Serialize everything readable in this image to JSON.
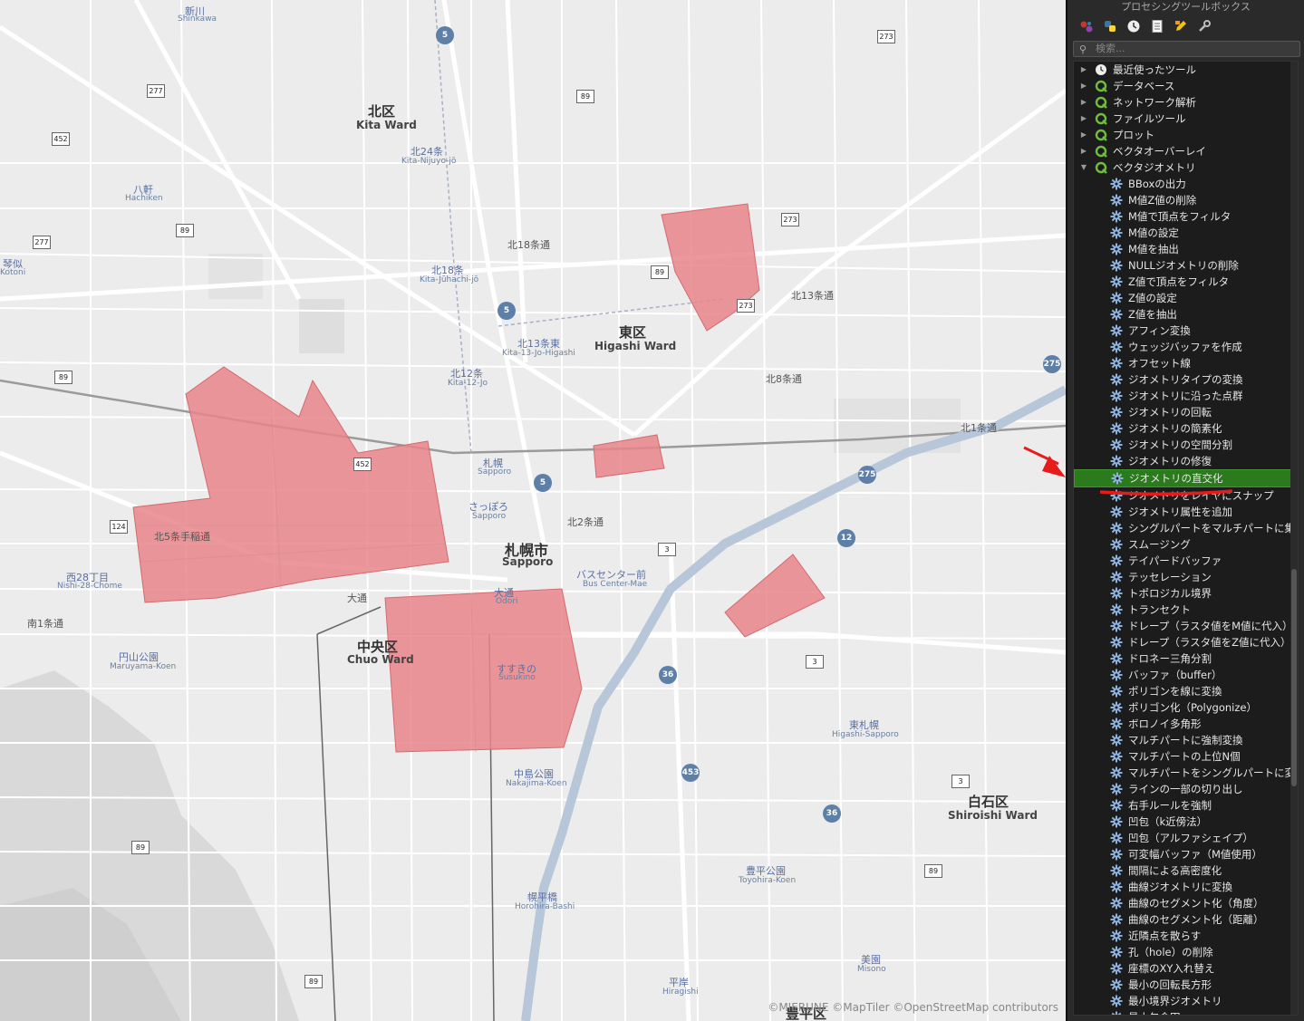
{
  "panel": {
    "title": "プロセシングツールボックス",
    "search_placeholder": "検索...",
    "groups": [
      {
        "label": "最近使ったツール",
        "icon": "clock-icon"
      },
      {
        "label": "データベース",
        "icon": "qgis-icon"
      },
      {
        "label": "ネットワーク解析",
        "icon": "qgis-icon"
      },
      {
        "label": "ファイルツール",
        "icon": "qgis-icon"
      },
      {
        "label": "プロット",
        "icon": "qgis-icon"
      },
      {
        "label": "ベクタオーバーレイ",
        "icon": "qgis-icon"
      },
      {
        "label": "ベクタジオメトリ",
        "icon": "qgis-icon"
      }
    ],
    "tools": [
      "BBoxの出力",
      "M値Z値の削除",
      "M値で頂点をフィルタ",
      "M値の設定",
      "M値を抽出",
      "NULLジオメトリの削除",
      "Z値で頂点をフィルタ",
      "Z値の設定",
      "Z値を抽出",
      "アフィン変換",
      "ウェッジバッファを作成",
      "オフセット線",
      "ジオメトリタイプの変換",
      "ジオメトリに沿った点群",
      "ジオメトリの回転",
      "ジオメトリの簡素化",
      "ジオメトリの空間分割",
      "ジオメトリの修復",
      "ジオメトリの直交化",
      "ジオメトリをレイヤにスナップ",
      "ジオメトリ属性を追加",
      "シングルパートをマルチパートに集約",
      "スムージング",
      "テイパードバッファ",
      "テッセレーション",
      "トポロジカル境界",
      "トランセクト",
      "ドレープ（ラスタ値をM値に代入）",
      "ドレープ（ラスタ値をZ値に代入）",
      "ドロネー三角分割",
      "バッファ（buffer）",
      "ポリゴンを線に変換",
      "ポリゴン化（Polygonize）",
      "ボロノイ多角形",
      "マルチパートに強制変換",
      "マルチパートの上位N個",
      "マルチパートをシングルパートに変換",
      "ラインの一部の切り出し",
      "右手ルールを強制",
      "凹包（k近傍法）",
      "凹包（アルファシェイプ）",
      "可変幅バッファ（M値使用）",
      "間隔による高密度化",
      "曲線ジオメトリに変換",
      "曲線のセグメント化（角度）",
      "曲線のセグメント化（距離）",
      "近隣点を散らす",
      "孔（hole）の削除",
      "座標のXY入れ替え",
      "最小の回転長方形",
      "最小境界ジオメトリ",
      "最小包含円"
    ],
    "selected_tool_index": 18
  },
  "map": {
    "attribution": "©MIERUNE ©MapTiler ©OpenStreetMap contributors",
    "wards": [
      {
        "jp": "北区",
        "en": "Kita Ward"
      },
      {
        "jp": "東区",
        "en": "Higashi Ward"
      },
      {
        "jp": "中央区",
        "en": "Chuo Ward"
      },
      {
        "jp": "白石区",
        "en": "Shiroishi Ward"
      },
      {
        "jp": "豊平区",
        "en": ""
      }
    ],
    "city": {
      "jp": "札幌市",
      "en": "Sapporo"
    },
    "stations": [
      {
        "jp": "新川",
        "en": "Shinkawa"
      },
      {
        "jp": "八軒",
        "en": "Hachiken"
      },
      {
        "jp": "琴似",
        "en": "Kotoni"
      },
      {
        "jp": "北24条",
        "en": "Kita-Nijuyo-jō"
      },
      {
        "jp": "北18条",
        "en": "Kita-Jūhachi-jō"
      },
      {
        "jp": "北13条東",
        "en": "Kita-13-Jo-Higashi"
      },
      {
        "jp": "北12条",
        "en": "Kita-12-Jo"
      },
      {
        "jp": "札幌",
        "en": "Sapporo"
      },
      {
        "jp": "さっぽろ",
        "en": "Sapporo"
      },
      {
        "jp": "西28丁目",
        "en": "Nishi-28-Chome"
      },
      {
        "jp": "円山公園",
        "en": "Maruyama-Koen"
      },
      {
        "jp": "大通",
        "en": "Odori"
      },
      {
        "jp": "バスセンター前",
        "en": "Bus Center-Mae"
      },
      {
        "jp": "すすきの",
        "en": "Susukino"
      },
      {
        "jp": "中島公園",
        "en": "Nakajima-Koen"
      },
      {
        "jp": "幌平橋",
        "en": "Horohira-Bashi"
      },
      {
        "jp": "東札幌",
        "en": "Higashi-Sapporo"
      },
      {
        "jp": "豊平公園",
        "en": "Toyohira-Koen"
      },
      {
        "jp": "平岸",
        "en": "Hiragishi"
      },
      {
        "jp": "美園",
        "en": "Misono"
      }
    ],
    "route_shields": [
      "277",
      "452",
      "89",
      "124",
      "5",
      "273",
      "3",
      "12",
      "36",
      "453",
      "275"
    ],
    "streets": [
      "北18条通",
      "北13条通",
      "北8条通",
      "北5条手稲通",
      "北2条通",
      "北1条通",
      "大通",
      "南1条通"
    ],
    "polygon_color": "#e8858a"
  }
}
